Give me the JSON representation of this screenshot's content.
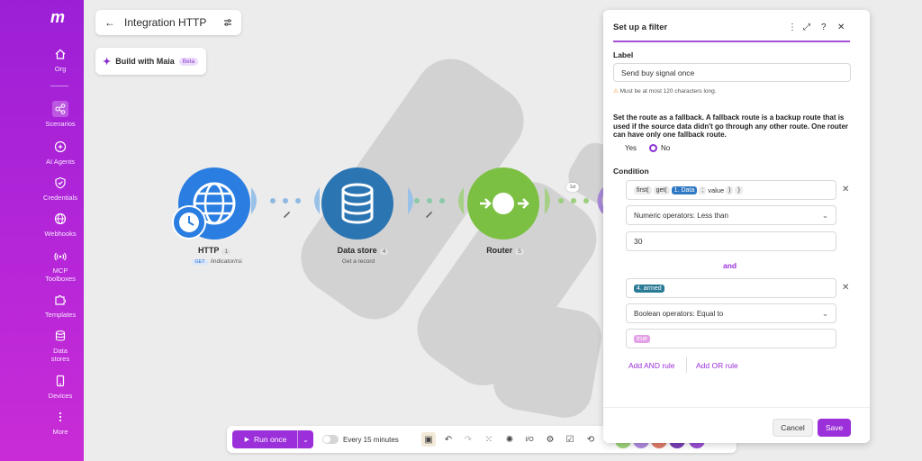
{
  "sidebar": {
    "logo": "m",
    "items": [
      {
        "label": "Org",
        "icon": "home-icon"
      },
      {
        "label": "Scenarios",
        "icon": "share-icon"
      },
      {
        "label": "AI Agents",
        "icon": "sparkle-icon"
      },
      {
        "label": "Credentials",
        "icon": "shield-icon"
      },
      {
        "label": "Webhooks",
        "icon": "globe-icon"
      },
      {
        "label": "MCP Toolboxes",
        "icon": "signal-icon"
      },
      {
        "label": "Templates",
        "icon": "puzzle-icon"
      },
      {
        "label": "Data stores",
        "icon": "database-icon"
      },
      {
        "label": "Devices",
        "icon": "phone-icon"
      },
      {
        "label": "More",
        "icon": "more-icon"
      }
    ]
  },
  "header": {
    "title": "Integration HTTP",
    "maia_label": "Build with Maia",
    "beta_label": "Beta"
  },
  "modules": [
    {
      "name": "HTTP",
      "badge": "1",
      "method": "GET",
      "sub": "/indicator/rsi",
      "color": "#2a7de1"
    },
    {
      "name": "Data store",
      "badge": "4",
      "sub": "Get a record",
      "color": "#2b75b3"
    },
    {
      "name": "Router",
      "badge": "5",
      "color": "#7cc043"
    }
  ],
  "route_label": "1st",
  "toolbar": {
    "run_label": "Run once",
    "schedule_label": "Every 15 minutes"
  },
  "filter_panel": {
    "title": "Set up a filter",
    "label_heading": "Label",
    "label_value": "Send buy signal once",
    "label_hint": "Must be at most 120 characters long.",
    "fallback_desc": "Set the route as a fallback. A fallback route is a backup route that is used if the source data didn't go through any other route. One router can have only one fallback route.",
    "fallback_yes": "Yes",
    "fallback_no": "No",
    "condition_heading": "Condition",
    "rule1": {
      "f_first": "first(",
      "f_get": "get(",
      "chip_data": "1. Data",
      "sep": ";",
      "f_value": "value",
      "close1": ")",
      "close2": ")",
      "operator": "Numeric operators: Less than",
      "value": "30"
    },
    "and_label": "and",
    "rule2": {
      "chip": "4. armed",
      "operator": "Boolean operators: Equal to",
      "value": "true"
    },
    "add_and": "Add AND rule",
    "add_or": "Add OR rule",
    "cancel": "Cancel",
    "save": "Save"
  },
  "colors": {
    "accent": "#9b2fd9",
    "sidebar_top": "#9c1fd6",
    "router": "#7cc043",
    "http": "#2a7de1",
    "datastore": "#2b75b3"
  }
}
